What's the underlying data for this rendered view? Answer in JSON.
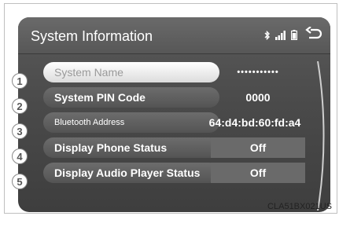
{
  "header": {
    "title": "System Information"
  },
  "icons": {
    "bluetooth": "bluetooth-icon",
    "signal": "signal-bars-icon",
    "battery": "battery-icon",
    "back": "back-icon"
  },
  "items": [
    {
      "number": "1",
      "label": "System Name",
      "value": "•••••••••••"
    },
    {
      "number": "2",
      "label": "System PIN Code",
      "value": "0000"
    },
    {
      "number": "3",
      "label": "Bluetooth Address",
      "value": "64:d4:bd:60:fd:a4"
    },
    {
      "number": "4",
      "label": "Display Phone Status",
      "value": "Off"
    },
    {
      "number": "5",
      "label": "Display Audio Player Status",
      "value": "Off"
    }
  ],
  "figure_code": "CLA51BX021US",
  "colors": {
    "screen": "#4a4a4a",
    "button_light": "#ffffff",
    "callout": "#ffffff"
  }
}
